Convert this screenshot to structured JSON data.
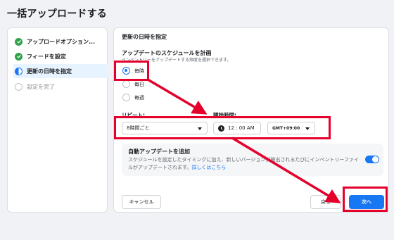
{
  "page": {
    "title": "一括アップロードする"
  },
  "sidebar": {
    "steps": [
      {
        "label": "アップロードオプション...",
        "state": "done"
      },
      {
        "label": "フィードを設定",
        "state": "done"
      },
      {
        "label": "更新の日時を指定",
        "state": "active"
      },
      {
        "label": "設定を完了",
        "state": "todo"
      }
    ]
  },
  "main": {
    "section_title": "更新の日時を指定",
    "schedule": {
      "title": "アップデートのスケジュールを計画",
      "description": "インベントリーをアップデートする頻度を選択できます。",
      "options": [
        {
          "label": "毎時",
          "selected": true
        },
        {
          "label": "毎日",
          "selected": false
        },
        {
          "label": "毎週",
          "selected": false
        }
      ]
    },
    "repeat": {
      "label": "リピート:",
      "value": "8時間ごと"
    },
    "start_time": {
      "label": "開始時間:",
      "value": "12 : 00 AM",
      "timezone": "GMT+09:00"
    },
    "auto_update": {
      "title": "自動アップデートを追加",
      "description": "スケジュールを設定したタイミングに加え、新しいバージョンが検出されるたびにインベントリーファイルがアップデートされます。",
      "link": "詳しくはこちら",
      "enabled": true
    },
    "buttons": {
      "cancel": "キャンセル",
      "back": "戻る",
      "next": "次へ"
    }
  },
  "colors": {
    "accent": "#1877f2",
    "annotation": "#e4002b",
    "success": "#31a24c"
  },
  "icons": {
    "done": "check-circle-icon",
    "active": "half-circle-icon",
    "todo": "empty-circle-icon",
    "clock": "clock-icon",
    "caret": "caret-down-icon"
  }
}
